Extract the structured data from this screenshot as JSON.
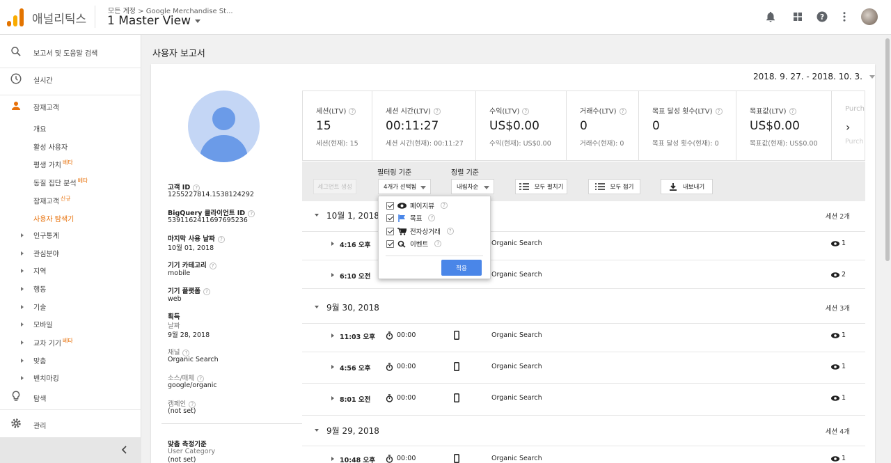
{
  "header": {
    "app_title": "애널리틱스",
    "breadcrumb": "모든 계정 > Google Merchandise St...",
    "view_name": "1 Master View"
  },
  "sidebar": {
    "search_label": "보고서 및 도움말 검색",
    "realtime": "실시간",
    "audience": "잠재고객",
    "audience_items": [
      {
        "label": "개요",
        "badge": ""
      },
      {
        "label": "활성 사용자",
        "badge": ""
      },
      {
        "label": "평생 가치",
        "badge": "베타"
      },
      {
        "label": "동질 집단 분석",
        "badge": "베타"
      },
      {
        "label": "잠재고객",
        "badge": "신규"
      },
      {
        "label": "사용자 탐색기",
        "badge": ""
      }
    ],
    "groups": [
      {
        "label": "인구통계",
        "badge": ""
      },
      {
        "label": "관심분야",
        "badge": ""
      },
      {
        "label": "지역",
        "badge": ""
      },
      {
        "label": "행동",
        "badge": ""
      },
      {
        "label": "기술",
        "badge": ""
      },
      {
        "label": "모바일",
        "badge": ""
      },
      {
        "label": "교차 기기",
        "badge": "베타"
      },
      {
        "label": "맞춤",
        "badge": ""
      },
      {
        "label": "벤치마킹",
        "badge": ""
      }
    ],
    "discover": "탐색",
    "admin": "관리",
    "collapse_icon": "chevron-left-icon"
  },
  "page": {
    "title": "사용자 보고서",
    "date_range": "2018. 9. 27. - 2018. 10. 3."
  },
  "profile": {
    "client_id_label": "고객 ID",
    "client_id": "1255227814.1538124292",
    "bq_label": "BigQuery 클라이언트 ID",
    "bq_id": "5391162411697695236",
    "last_seen_label": "마지막 사용 날짜",
    "last_seen": "10월 01, 2018",
    "device_label": "기기 카테고리",
    "device": "mobile",
    "platform_label": "기기 플랫폼",
    "platform": "web",
    "acq_label": "획득",
    "acq_date_label": "날짜",
    "acq_date": "9월 28, 2018",
    "channel_label": "채널",
    "channel": "Organic Search",
    "source_label": "소스/매체",
    "source": "google/organic",
    "campaign_label": "캠페인",
    "campaign": "(not set)",
    "custom_label": "맞춤 측정기준",
    "custom_sub": "User Category",
    "custom_val": "(not set)"
  },
  "metrics": [
    {
      "title": "세션(LTV)",
      "value": "15",
      "sub": "세션(현재): 15"
    },
    {
      "title": "세션 시간(LTV)",
      "value": "00:11:27",
      "sub": "세션 시간(현재): 00:11:27"
    },
    {
      "title": "수익(LTV)",
      "value": "US$0.00",
      "sub": "수익(현재): US$0.00"
    },
    {
      "title": "거래수(LTV)",
      "value": "0",
      "sub": "거래수(현재): 0"
    },
    {
      "title": "목표 달성 횟수(LTV)",
      "value": "0",
      "sub": "목표 달성 횟수(현재): 0"
    },
    {
      "title": "목표값(LTV)",
      "value": "US$0.00",
      "sub": "목표값(현재): US$0.00"
    },
    {
      "title": "Purch",
      "value": "",
      "sub": "Purch"
    }
  ],
  "toolbar": {
    "segment_btn": "세그먼트 생성",
    "filter_label": "필터링 기준",
    "filter_value": "4개가 선택됨",
    "sort_label": "정렬 기준",
    "sort_value": "내림차순",
    "expand_all": "모두 펼치기",
    "collapse_all": "모두 접기",
    "export": "내보내기"
  },
  "filter_menu": {
    "options": [
      "페이지뷰",
      "목표",
      "전자상거래",
      "이벤트"
    ],
    "apply": "적용"
  },
  "days": [
    {
      "date": "10월 1, 2018",
      "count": "세션 2개",
      "sessions": [
        {
          "time": "4:16 오후",
          "duration": "",
          "source": "Organic Search",
          "views": "1"
        },
        {
          "time": "6:10 오전",
          "duration": "",
          "source": "Organic Search",
          "views": "2"
        }
      ]
    },
    {
      "date": "9월 30, 2018",
      "count": "세션 3개",
      "sessions": [
        {
          "time": "11:03 오후",
          "duration": "00:00",
          "source": "Organic Search",
          "views": "1"
        },
        {
          "time": "4:56 오후",
          "duration": "00:00",
          "source": "Organic Search",
          "views": "1"
        },
        {
          "time": "8:01 오전",
          "duration": "00:00",
          "source": "Organic Search",
          "views": "1"
        }
      ]
    },
    {
      "date": "9월 29, 2018",
      "count": "세션 4개",
      "sessions": [
        {
          "time": "10:48 오후",
          "duration": "00:00",
          "source": "Organic Search",
          "views": "1"
        }
      ]
    }
  ],
  "colors": {
    "accent": "#e8710a",
    "apply_blue": "#4a86e8",
    "avatar_blue": "#6b9be8"
  }
}
